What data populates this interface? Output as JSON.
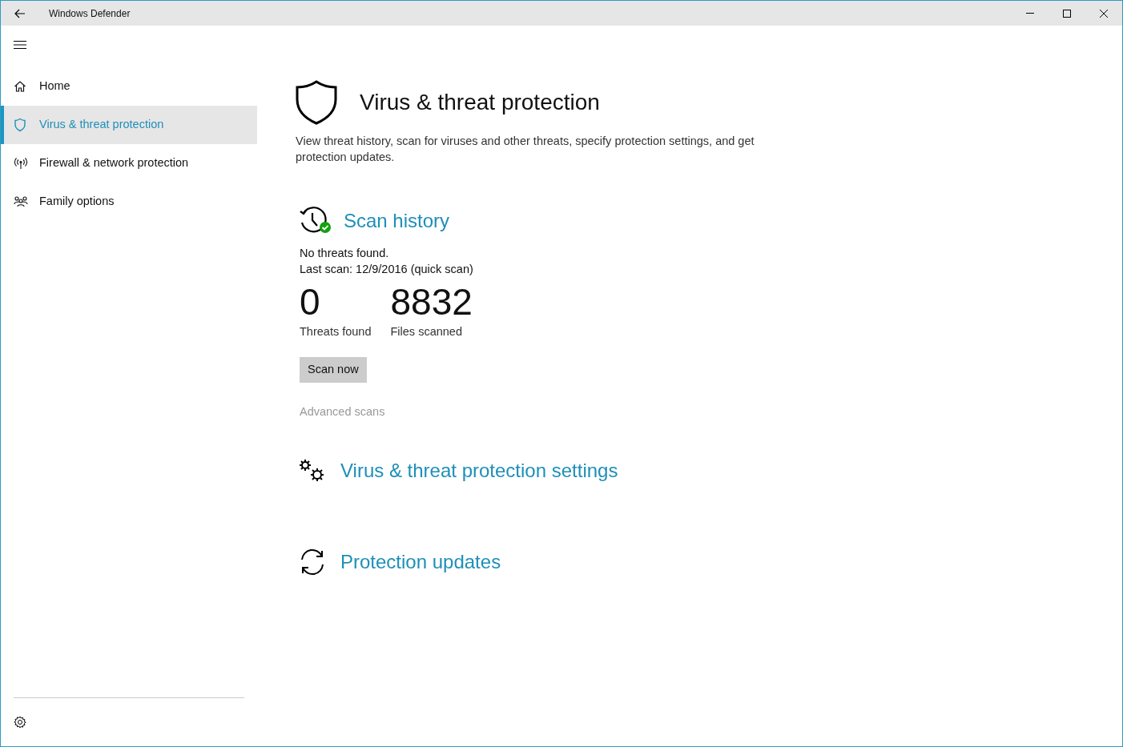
{
  "window": {
    "title": "Windows Defender"
  },
  "nav": [
    {
      "label": "Home",
      "kind": "home",
      "selected": false
    },
    {
      "label": "Virus & threat protection",
      "kind": "shield",
      "selected": true
    },
    {
      "label": "Firewall & network protection",
      "kind": "antenna",
      "selected": false
    },
    {
      "label": "Family options",
      "kind": "family",
      "selected": false
    }
  ],
  "page": {
    "title": "Virus & threat protection",
    "description": "View threat history, scan for viruses and other threats, specify protection settings, and get protection updates."
  },
  "scan_history": {
    "title": "Scan history",
    "status": "No threats found.",
    "last_scan": "Last scan: 12/9/2016 (quick scan)",
    "stats": [
      {
        "value": "0",
        "label": "Threats found"
      },
      {
        "value": "8832",
        "label": "Files scanned"
      }
    ],
    "button": "Scan now",
    "link": "Advanced scans"
  },
  "sections": [
    {
      "title": "Virus & threat protection settings",
      "kind": "settings"
    },
    {
      "title": "Protection updates",
      "kind": "updates"
    }
  ]
}
